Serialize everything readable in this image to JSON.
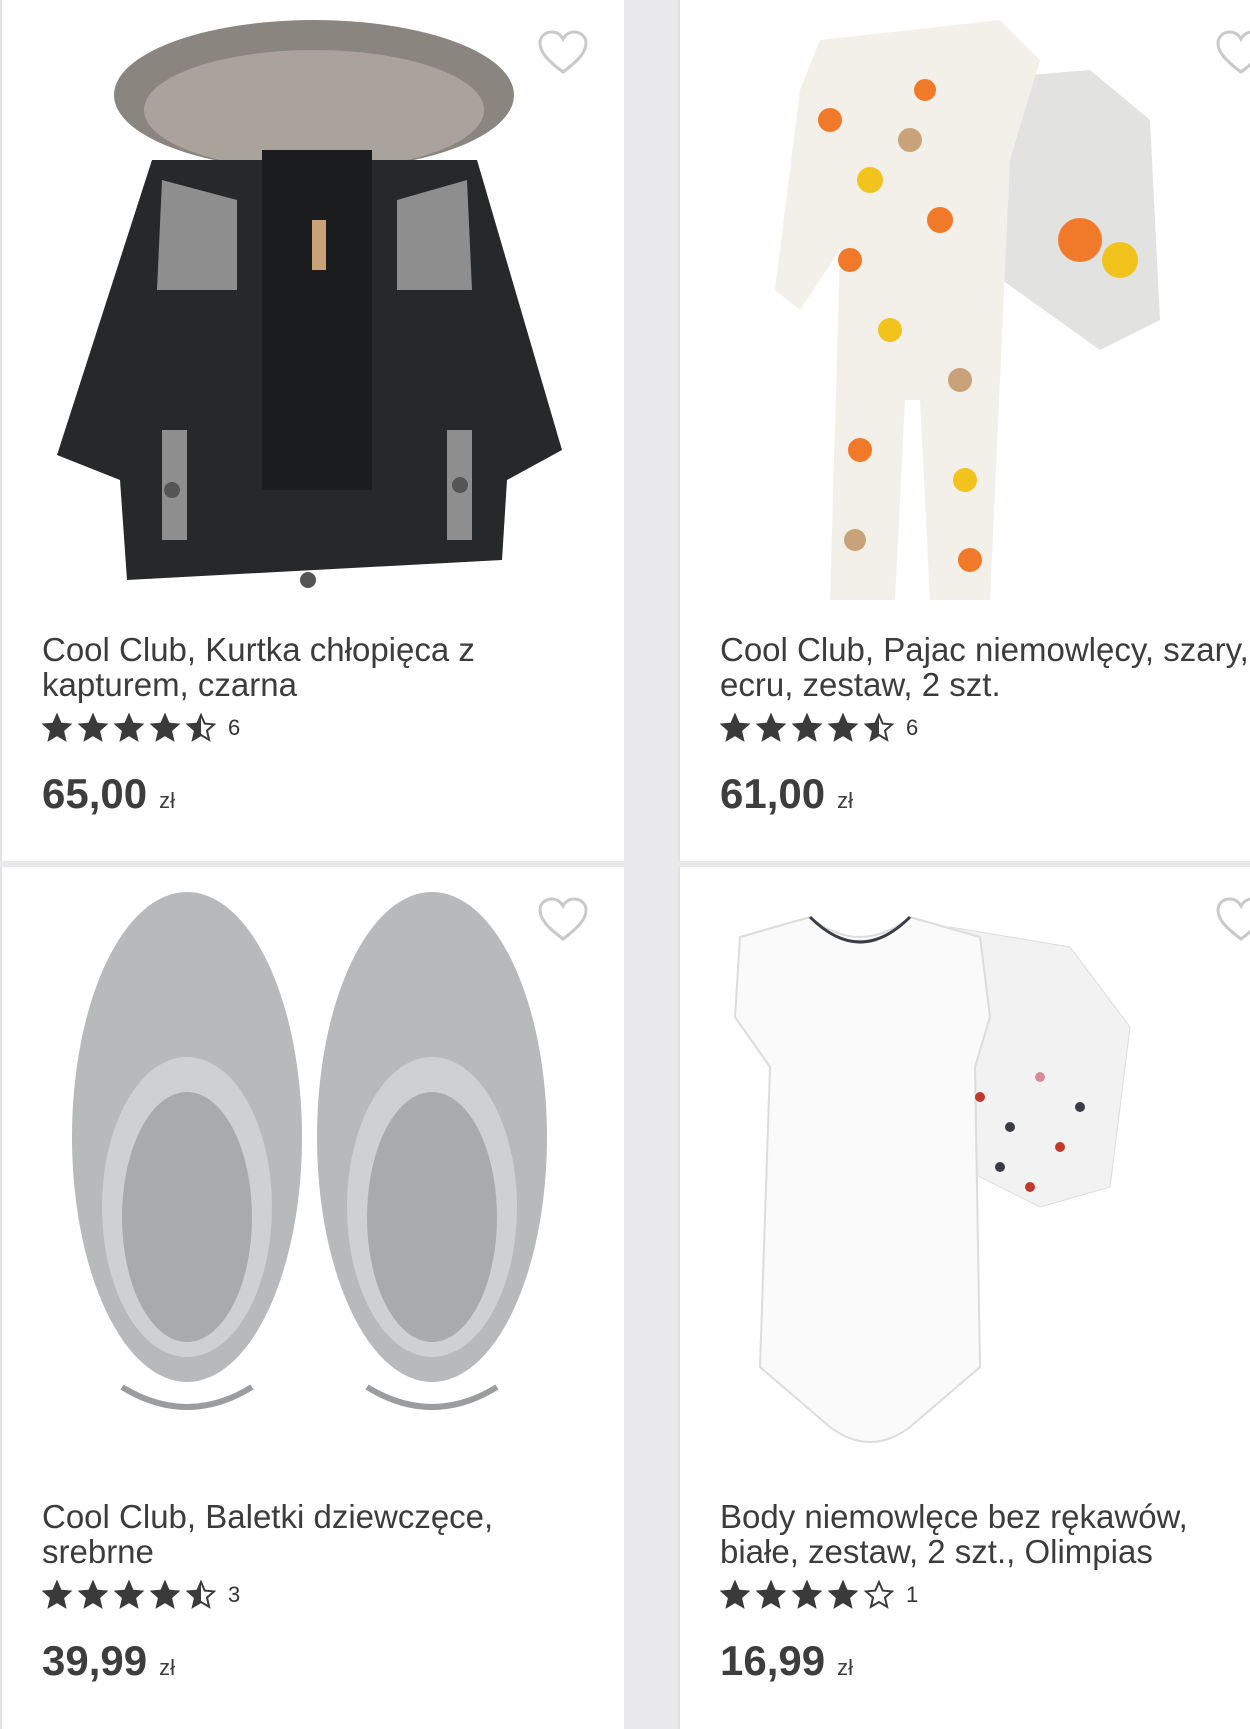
{
  "products": [
    {
      "title": "Cool Club, Kurtka chłopięca z\nkapturem, czarna",
      "rating_count": "6",
      "rating": 4.5,
      "price": "65,00",
      "currency": "zł"
    },
    {
      "title": "Cool Club, Pajac niemowlęcy, szary,\necru, zestaw, 2 szt.",
      "rating_count": "6",
      "rating": 4.5,
      "price": "61,00",
      "currency": "zł"
    },
    {
      "title": "Cool Club, Baletki dziewczęce,\nsrebrne",
      "rating_count": "3",
      "rating": 4.5,
      "price": "39,99",
      "currency": "zł"
    },
    {
      "title": "Body niemowlęce bez rękawów,\nbiałe, zestaw, 2 szt., Olimpias",
      "rating_count": "1",
      "rating": 4,
      "price": "16,99",
      "currency": "zł"
    }
  ],
  "colors": {
    "star": "#3a3a3a",
    "heart_outline": "#c9c9c9",
    "text": "#3c3c3c"
  },
  "icons": {
    "favorite": "heart-outline-icon",
    "star_full": "star-icon",
    "star_half": "star-half-icon",
    "star_empty": "star-empty-icon"
  }
}
